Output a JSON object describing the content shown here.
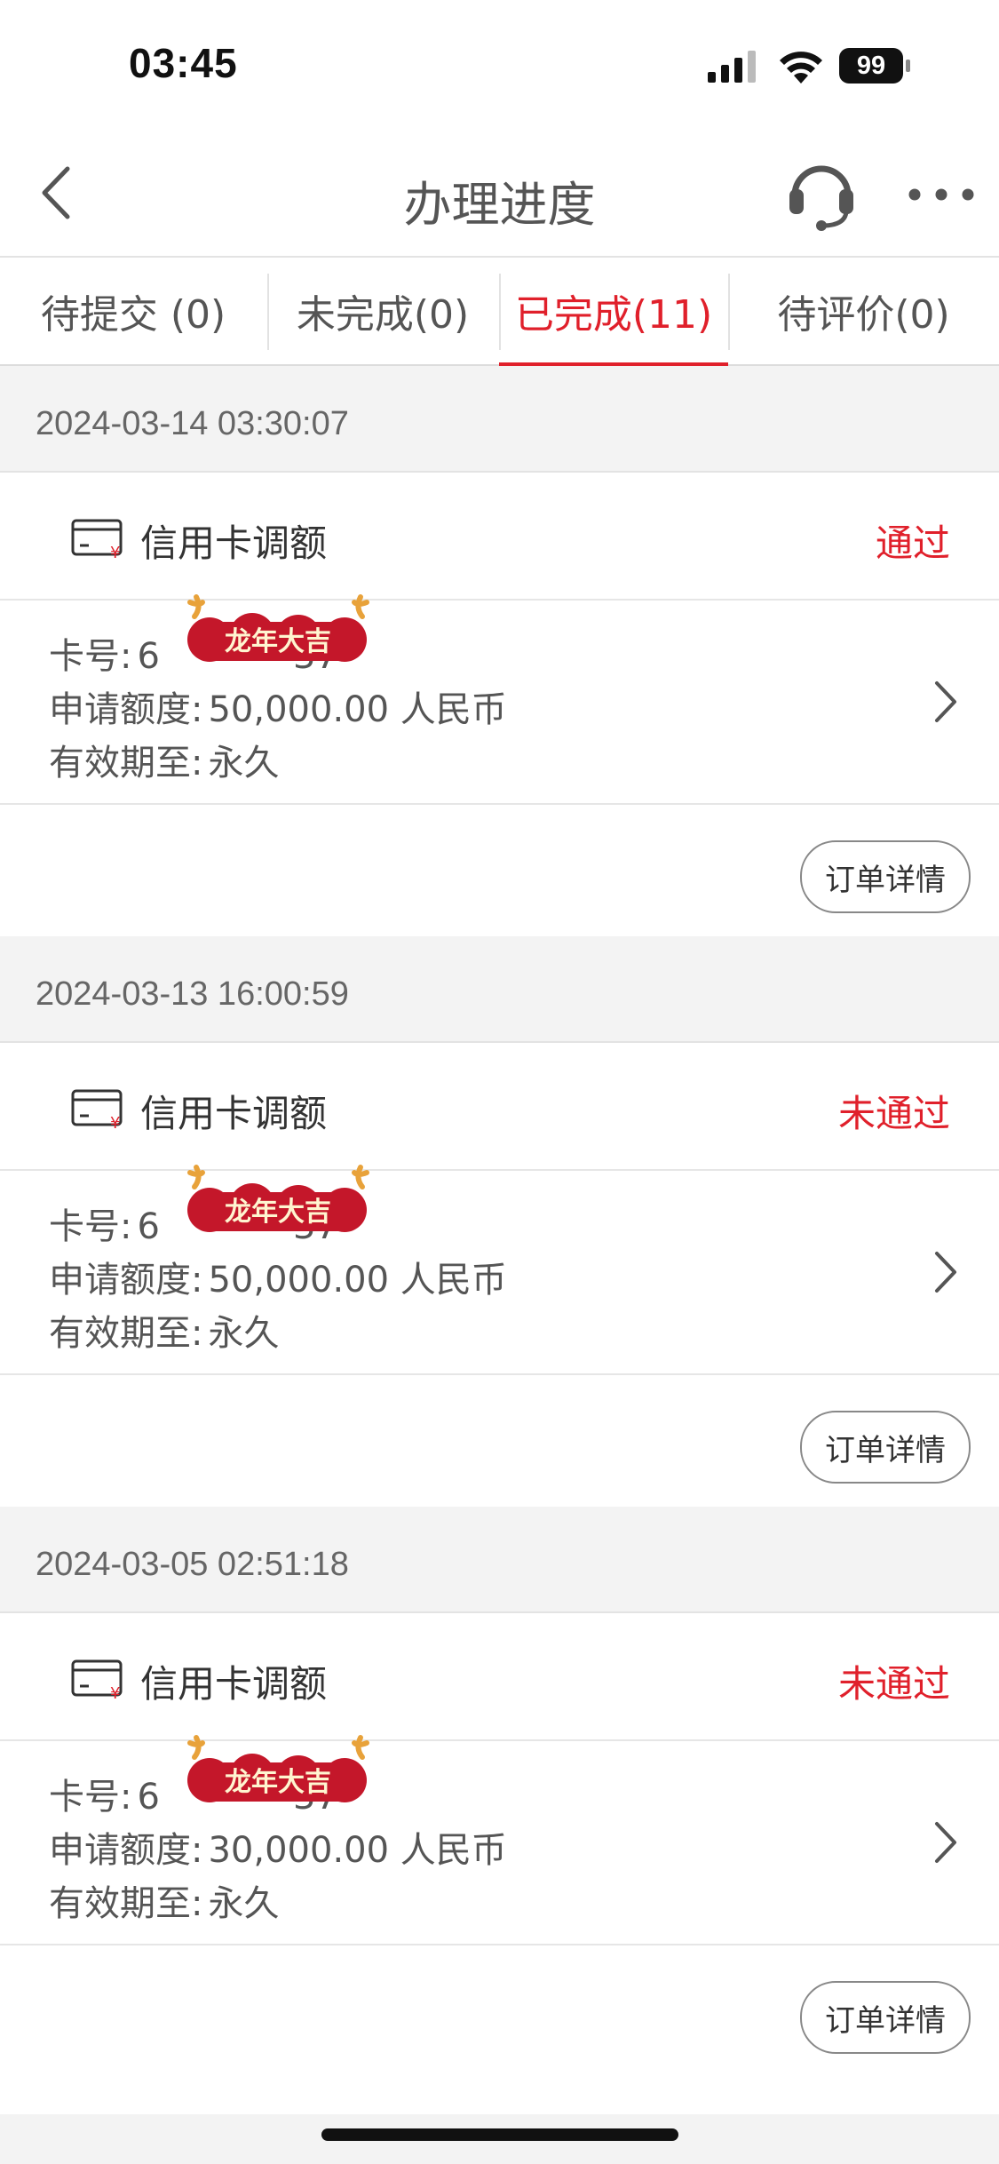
{
  "status_bar": {
    "time": "03:45",
    "battery": "99"
  },
  "nav": {
    "title": "办理进度"
  },
  "tabs": [
    {
      "label": "待提交 (0)"
    },
    {
      "label": "未完成(0)"
    },
    {
      "label": "已完成(11)",
      "active": true
    },
    {
      "label": "待评价(0)"
    }
  ],
  "records": [
    {
      "date": "2024-03-14 03:30:07",
      "type": "信用卡调额",
      "status": "通过",
      "card_label": "卡号:",
      "card_prefix": "6",
      "card_suffix": "37",
      "amount_label": "申请额度:",
      "amount": "50,000.00 人民币",
      "valid_label": "有效期至:",
      "valid": "永久",
      "detail_button": "订单详情",
      "sticker": "龙年大吉"
    },
    {
      "date": "2024-03-13 16:00:59",
      "type": "信用卡调额",
      "status": "未通过",
      "card_label": "卡号:",
      "card_prefix": "6",
      "card_suffix": "37",
      "amount_label": "申请额度:",
      "amount": "50,000.00 人民币",
      "valid_label": "有效期至:",
      "valid": "永久",
      "detail_button": "订单详情",
      "sticker": "龙年大吉"
    },
    {
      "date": "2024-03-05 02:51:18",
      "type": "信用卡调额",
      "status": "未通过",
      "card_label": "卡号:",
      "card_prefix": "6",
      "card_suffix": "37",
      "amount_label": "申请额度:",
      "amount": "30,000.00 人民币",
      "valid_label": "有效期至:",
      "valid": "永久",
      "detail_button": "订单详情",
      "sticker": "龙年大吉"
    }
  ],
  "colors": {
    "accent": "#e0202b",
    "background": "#f3f3f3"
  }
}
